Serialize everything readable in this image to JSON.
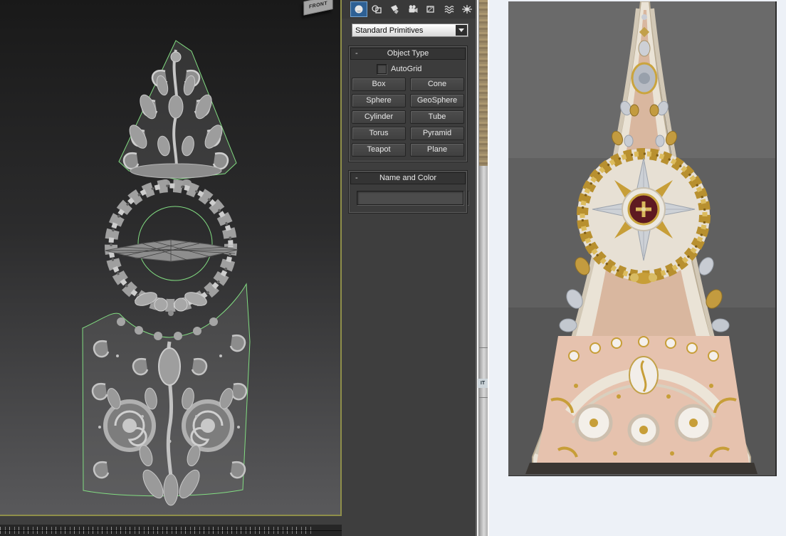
{
  "viewport": {
    "label": "FRONT"
  },
  "command_panel": {
    "category_icons": [
      {
        "name": "geometry",
        "active": true
      },
      {
        "name": "shapes",
        "active": false
      },
      {
        "name": "lights",
        "active": false
      },
      {
        "name": "cameras",
        "active": false
      },
      {
        "name": "helpers",
        "active": false
      },
      {
        "name": "space-warps",
        "active": false
      },
      {
        "name": "systems",
        "active": false
      }
    ],
    "dropdown_value": "Standard Primitives",
    "object_type": {
      "collapse": "-",
      "title": "Object Type",
      "autogrid_label": "AutoGrid",
      "autogrid_checked": false,
      "buttons": [
        "Box",
        "Cone",
        "Sphere",
        "GeoSphere",
        "Cylinder",
        "Tube",
        "Torus",
        "Pyramid",
        "Teapot",
        "Plane"
      ]
    },
    "name_and_color": {
      "collapse": "-",
      "title": "Name and Color",
      "name_value": ""
    }
  },
  "side_strip": {
    "label": "IT"
  },
  "colors": {
    "viewport_border": "#8f8f4a",
    "selection_outline": "#82dd82",
    "active_category_blue": "#2e6094",
    "panel_bg": "#3e3e3e",
    "photo_bg": "#606060",
    "spire_cream": "#eae3d6",
    "spire_peach": "#d9b79f",
    "panel_pink": "#e6c2ae",
    "ornament_gold": "#c79e38",
    "ornament_silver": "#cdd1d6",
    "star_center_red": "#5e1a21"
  }
}
